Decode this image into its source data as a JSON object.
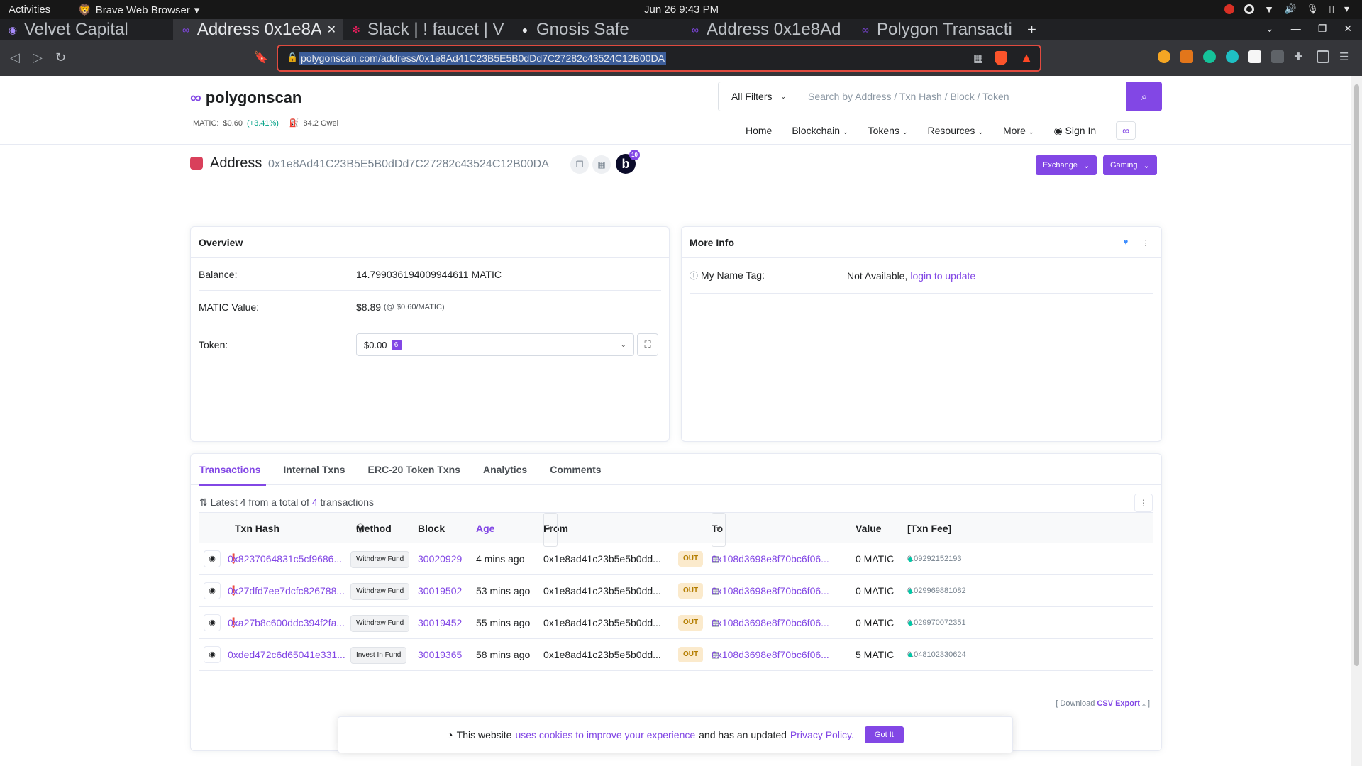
{
  "os": {
    "activities": "Activities",
    "app_name": "Brave Web Browser",
    "clock": "Jun 26  9:43 PM"
  },
  "tabs": [
    {
      "label": "Velvet Capital"
    },
    {
      "label": "Address 0x1e8A"
    },
    {
      "label": "Slack | ! faucet | V"
    },
    {
      "label": "Gnosis Safe"
    },
    {
      "label": "Address 0x1e8Ad"
    },
    {
      "label": "Polygon Transacti"
    }
  ],
  "toolbar": {
    "url": "polygonscan.com/address/0x1e8Ad41C23B5E5B0dDd7C27282c43524C12B00DA"
  },
  "site": {
    "logo": "polygonscan",
    "matic_price_label": "MATIC:",
    "matic_price": "$0.60",
    "matic_change": "(+3.41%)",
    "separator": "|",
    "gas": "84.2 Gwei",
    "filter_label": "All Filters",
    "search_placeholder": "Search by Address / Txn Hash / Block / Token",
    "nav": {
      "home": "Home",
      "blockchain": "Blockchain",
      "tokens": "Tokens",
      "resources": "Resources",
      "more": "More",
      "sign_in": "Sign In"
    }
  },
  "address": {
    "label": "Address",
    "hash": "0x1e8Ad41C23B5E5B0dDd7C27282c43524C12B00DA",
    "badge_letter": "b",
    "badge_count": "10",
    "exchange": "Exchange",
    "gaming": "Gaming"
  },
  "overview": {
    "title": "Overview",
    "balance_label": "Balance:",
    "balance_value": "14.799036194009944611 MATIC",
    "value_label": "MATIC Value:",
    "value_usd": "$8.89",
    "value_rate": "(@ $0.60/MATIC)",
    "token_label": "Token:",
    "token_value": "$0.00",
    "token_count": "6"
  },
  "more_info": {
    "title": "More Info",
    "name_tag_label": "My Name Tag:",
    "name_tag_value": "Not Available,",
    "name_tag_link": "login to update"
  },
  "txns": {
    "tabs": [
      "Transactions",
      "Internal Txns",
      "ERC-20 Token Txns",
      "Analytics",
      "Comments"
    ],
    "summary_prefix": "Latest 4 from a total of",
    "summary_count": "4",
    "summary_suffix": "transactions",
    "headers": {
      "hash": "Txn Hash",
      "method": "Method",
      "block": "Block",
      "age": "Age",
      "from": "From",
      "to": "To",
      "value": "Value",
      "fee": "[Txn Fee]"
    },
    "rows": [
      {
        "hash": "0x8237064831c5cf9686...",
        "method": "Withdraw Fund",
        "block": "30020929",
        "age": "4 mins ago",
        "from": "0x1e8ad41c23b5e5b0dd...",
        "dir": "OUT",
        "to": "0x108d3698e8f70bc6f06...",
        "value": "0 MATIC",
        "fee": "0.09292152193"
      },
      {
        "hash": "0x27dfd7ee7dcfc826788...",
        "method": "Withdraw Fund",
        "block": "30019502",
        "age": "53 mins ago",
        "from": "0x1e8ad41c23b5e5b0dd...",
        "dir": "OUT",
        "to": "0x108d3698e8f70bc6f06...",
        "value": "0 MATIC",
        "fee": "0.029969881082"
      },
      {
        "hash": "0xa27b8c600ddc394f2fa...",
        "method": "Withdraw Fund",
        "block": "30019452",
        "age": "55 mins ago",
        "from": "0x1e8ad41c23b5e5b0dd...",
        "dir": "OUT",
        "to": "0x108d3698e8f70bc6f06...",
        "value": "0 MATIC",
        "fee": "0.029970072351"
      },
      {
        "hash": "0xded472c6d65041e331...",
        "method": "Invest In Fund",
        "block": "30019365",
        "age": "58 mins ago",
        "from": "0x1e8ad41c23b5e5b0dd...",
        "dir": "OUT",
        "to": "0x108d3698e8f70bc6f06...",
        "value": "5 MATIC",
        "fee": "0.048102330624"
      }
    ],
    "csv_prefix": "[ Download",
    "csv_link": "CSV Export",
    "csv_suffix": "]"
  },
  "cookie": {
    "text1": "This website",
    "link1": "uses cookies to improve your experience",
    "text2": "and has an updated",
    "link2": "Privacy Policy.",
    "button": "Got It"
  },
  "colors": {
    "brand": "#8247e5",
    "error": "#de4437",
    "positive": "#00a186"
  }
}
